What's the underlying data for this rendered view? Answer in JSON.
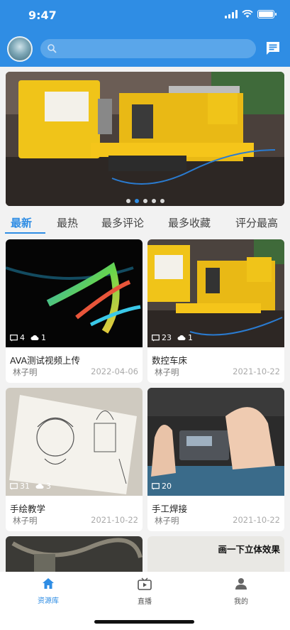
{
  "status_bar": {
    "time": "9:47"
  },
  "search": {
    "placeholder": ""
  },
  "banner": {
    "dots": 5,
    "active_dot": 1
  },
  "tabs": [
    {
      "label": "最新",
      "active": true
    },
    {
      "label": "最热",
      "active": false
    },
    {
      "label": "最多评论",
      "active": false
    },
    {
      "label": "最多收藏",
      "active": false
    },
    {
      "label": "评分最高",
      "active": false
    }
  ],
  "cards": [
    {
      "title": "AVA测试视频上传",
      "author": "林子明",
      "date": "2022-04-06",
      "comments": "4",
      "downloads": "1"
    },
    {
      "title": "数控车床",
      "author": "林子明",
      "date": "2021-10-22",
      "comments": "23",
      "downloads": "1"
    },
    {
      "title": "手绘教学",
      "author": "林子明",
      "date": "2021-10-22",
      "comments": "31",
      "downloads": "3"
    },
    {
      "title": "手工焊接",
      "author": "林子明",
      "date": "2021-10-22",
      "comments": "20",
      "downloads": ""
    }
  ],
  "partial_card_caption": "画一下立体效果",
  "bottom_nav": [
    {
      "label": "资源库",
      "icon": "home-icon",
      "active": true
    },
    {
      "label": "直播",
      "icon": "tv-icon",
      "active": false
    },
    {
      "label": "我的",
      "icon": "person-icon",
      "active": false
    }
  ],
  "colors": {
    "accent": "#2f8de4",
    "header": "#2f8de4"
  }
}
